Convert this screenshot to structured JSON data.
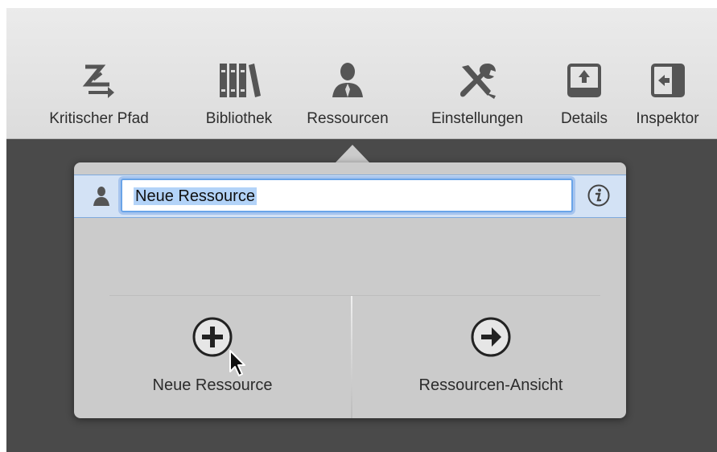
{
  "toolbar": {
    "items": [
      {
        "label": "Kritischer Pfad",
        "icon": "critical-path-icon"
      },
      {
        "label": "Bibliothek",
        "icon": "library-books-icon"
      },
      {
        "label": "Ressourcen",
        "icon": "resource-person-icon"
      },
      {
        "label": "Einstellungen",
        "icon": "tools-wrench-screwdriver-icon"
      },
      {
        "label": "Details",
        "icon": "details-upload-icon"
      },
      {
        "label": "Inspektor",
        "icon": "inspector-sidebar-icon"
      }
    ]
  },
  "popover": {
    "resource_name_value": "Neue Ressource",
    "info_icon": "info-icon",
    "actions": {
      "new_resource_label": "Neue Ressource",
      "resource_view_label": "Ressourcen-Ansicht"
    }
  },
  "colors": {
    "selection_highlight": "#b3d3f8",
    "focus_ring": "#6aa4e8",
    "popover_background": "#cbcbcb",
    "backdrop": "#4a4a4a"
  }
}
